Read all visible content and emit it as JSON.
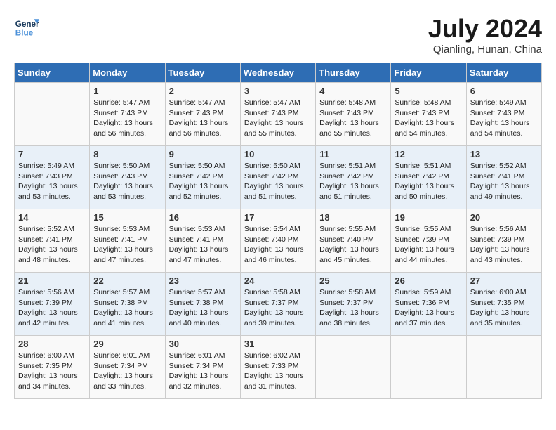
{
  "header": {
    "logo_line1": "General",
    "logo_line2": "Blue",
    "month": "July 2024",
    "location": "Qianling, Hunan, China"
  },
  "weekdays": [
    "Sunday",
    "Monday",
    "Tuesday",
    "Wednesday",
    "Thursday",
    "Friday",
    "Saturday"
  ],
  "weeks": [
    [
      {
        "day": "",
        "sunrise": "",
        "sunset": "",
        "daylight": ""
      },
      {
        "day": "1",
        "sunrise": "Sunrise: 5:47 AM",
        "sunset": "Sunset: 7:43 PM",
        "daylight": "Daylight: 13 hours and 56 minutes."
      },
      {
        "day": "2",
        "sunrise": "Sunrise: 5:47 AM",
        "sunset": "Sunset: 7:43 PM",
        "daylight": "Daylight: 13 hours and 56 minutes."
      },
      {
        "day": "3",
        "sunrise": "Sunrise: 5:47 AM",
        "sunset": "Sunset: 7:43 PM",
        "daylight": "Daylight: 13 hours and 55 minutes."
      },
      {
        "day": "4",
        "sunrise": "Sunrise: 5:48 AM",
        "sunset": "Sunset: 7:43 PM",
        "daylight": "Daylight: 13 hours and 55 minutes."
      },
      {
        "day": "5",
        "sunrise": "Sunrise: 5:48 AM",
        "sunset": "Sunset: 7:43 PM",
        "daylight": "Daylight: 13 hours and 54 minutes."
      },
      {
        "day": "6",
        "sunrise": "Sunrise: 5:49 AM",
        "sunset": "Sunset: 7:43 PM",
        "daylight": "Daylight: 13 hours and 54 minutes."
      }
    ],
    [
      {
        "day": "7",
        "sunrise": "Sunrise: 5:49 AM",
        "sunset": "Sunset: 7:43 PM",
        "daylight": "Daylight: 13 hours and 53 minutes."
      },
      {
        "day": "8",
        "sunrise": "Sunrise: 5:50 AM",
        "sunset": "Sunset: 7:43 PM",
        "daylight": "Daylight: 13 hours and 53 minutes."
      },
      {
        "day": "9",
        "sunrise": "Sunrise: 5:50 AM",
        "sunset": "Sunset: 7:42 PM",
        "daylight": "Daylight: 13 hours and 52 minutes."
      },
      {
        "day": "10",
        "sunrise": "Sunrise: 5:50 AM",
        "sunset": "Sunset: 7:42 PM",
        "daylight": "Daylight: 13 hours and 51 minutes."
      },
      {
        "day": "11",
        "sunrise": "Sunrise: 5:51 AM",
        "sunset": "Sunset: 7:42 PM",
        "daylight": "Daylight: 13 hours and 51 minutes."
      },
      {
        "day": "12",
        "sunrise": "Sunrise: 5:51 AM",
        "sunset": "Sunset: 7:42 PM",
        "daylight": "Daylight: 13 hours and 50 minutes."
      },
      {
        "day": "13",
        "sunrise": "Sunrise: 5:52 AM",
        "sunset": "Sunset: 7:41 PM",
        "daylight": "Daylight: 13 hours and 49 minutes."
      }
    ],
    [
      {
        "day": "14",
        "sunrise": "Sunrise: 5:52 AM",
        "sunset": "Sunset: 7:41 PM",
        "daylight": "Daylight: 13 hours and 48 minutes."
      },
      {
        "day": "15",
        "sunrise": "Sunrise: 5:53 AM",
        "sunset": "Sunset: 7:41 PM",
        "daylight": "Daylight: 13 hours and 47 minutes."
      },
      {
        "day": "16",
        "sunrise": "Sunrise: 5:53 AM",
        "sunset": "Sunset: 7:41 PM",
        "daylight": "Daylight: 13 hours and 47 minutes."
      },
      {
        "day": "17",
        "sunrise": "Sunrise: 5:54 AM",
        "sunset": "Sunset: 7:40 PM",
        "daylight": "Daylight: 13 hours and 46 minutes."
      },
      {
        "day": "18",
        "sunrise": "Sunrise: 5:55 AM",
        "sunset": "Sunset: 7:40 PM",
        "daylight": "Daylight: 13 hours and 45 minutes."
      },
      {
        "day": "19",
        "sunrise": "Sunrise: 5:55 AM",
        "sunset": "Sunset: 7:39 PM",
        "daylight": "Daylight: 13 hours and 44 minutes."
      },
      {
        "day": "20",
        "sunrise": "Sunrise: 5:56 AM",
        "sunset": "Sunset: 7:39 PM",
        "daylight": "Daylight: 13 hours and 43 minutes."
      }
    ],
    [
      {
        "day": "21",
        "sunrise": "Sunrise: 5:56 AM",
        "sunset": "Sunset: 7:39 PM",
        "daylight": "Daylight: 13 hours and 42 minutes."
      },
      {
        "day": "22",
        "sunrise": "Sunrise: 5:57 AM",
        "sunset": "Sunset: 7:38 PM",
        "daylight": "Daylight: 13 hours and 41 minutes."
      },
      {
        "day": "23",
        "sunrise": "Sunrise: 5:57 AM",
        "sunset": "Sunset: 7:38 PM",
        "daylight": "Daylight: 13 hours and 40 minutes."
      },
      {
        "day": "24",
        "sunrise": "Sunrise: 5:58 AM",
        "sunset": "Sunset: 7:37 PM",
        "daylight": "Daylight: 13 hours and 39 minutes."
      },
      {
        "day": "25",
        "sunrise": "Sunrise: 5:58 AM",
        "sunset": "Sunset: 7:37 PM",
        "daylight": "Daylight: 13 hours and 38 minutes."
      },
      {
        "day": "26",
        "sunrise": "Sunrise: 5:59 AM",
        "sunset": "Sunset: 7:36 PM",
        "daylight": "Daylight: 13 hours and 37 minutes."
      },
      {
        "day": "27",
        "sunrise": "Sunrise: 6:00 AM",
        "sunset": "Sunset: 7:35 PM",
        "daylight": "Daylight: 13 hours and 35 minutes."
      }
    ],
    [
      {
        "day": "28",
        "sunrise": "Sunrise: 6:00 AM",
        "sunset": "Sunset: 7:35 PM",
        "daylight": "Daylight: 13 hours and 34 minutes."
      },
      {
        "day": "29",
        "sunrise": "Sunrise: 6:01 AM",
        "sunset": "Sunset: 7:34 PM",
        "daylight": "Daylight: 13 hours and 33 minutes."
      },
      {
        "day": "30",
        "sunrise": "Sunrise: 6:01 AM",
        "sunset": "Sunset: 7:34 PM",
        "daylight": "Daylight: 13 hours and 32 minutes."
      },
      {
        "day": "31",
        "sunrise": "Sunrise: 6:02 AM",
        "sunset": "Sunset: 7:33 PM",
        "daylight": "Daylight: 13 hours and 31 minutes."
      },
      {
        "day": "",
        "sunrise": "",
        "sunset": "",
        "daylight": ""
      },
      {
        "day": "",
        "sunrise": "",
        "sunset": "",
        "daylight": ""
      },
      {
        "day": "",
        "sunrise": "",
        "sunset": "",
        "daylight": ""
      }
    ]
  ]
}
